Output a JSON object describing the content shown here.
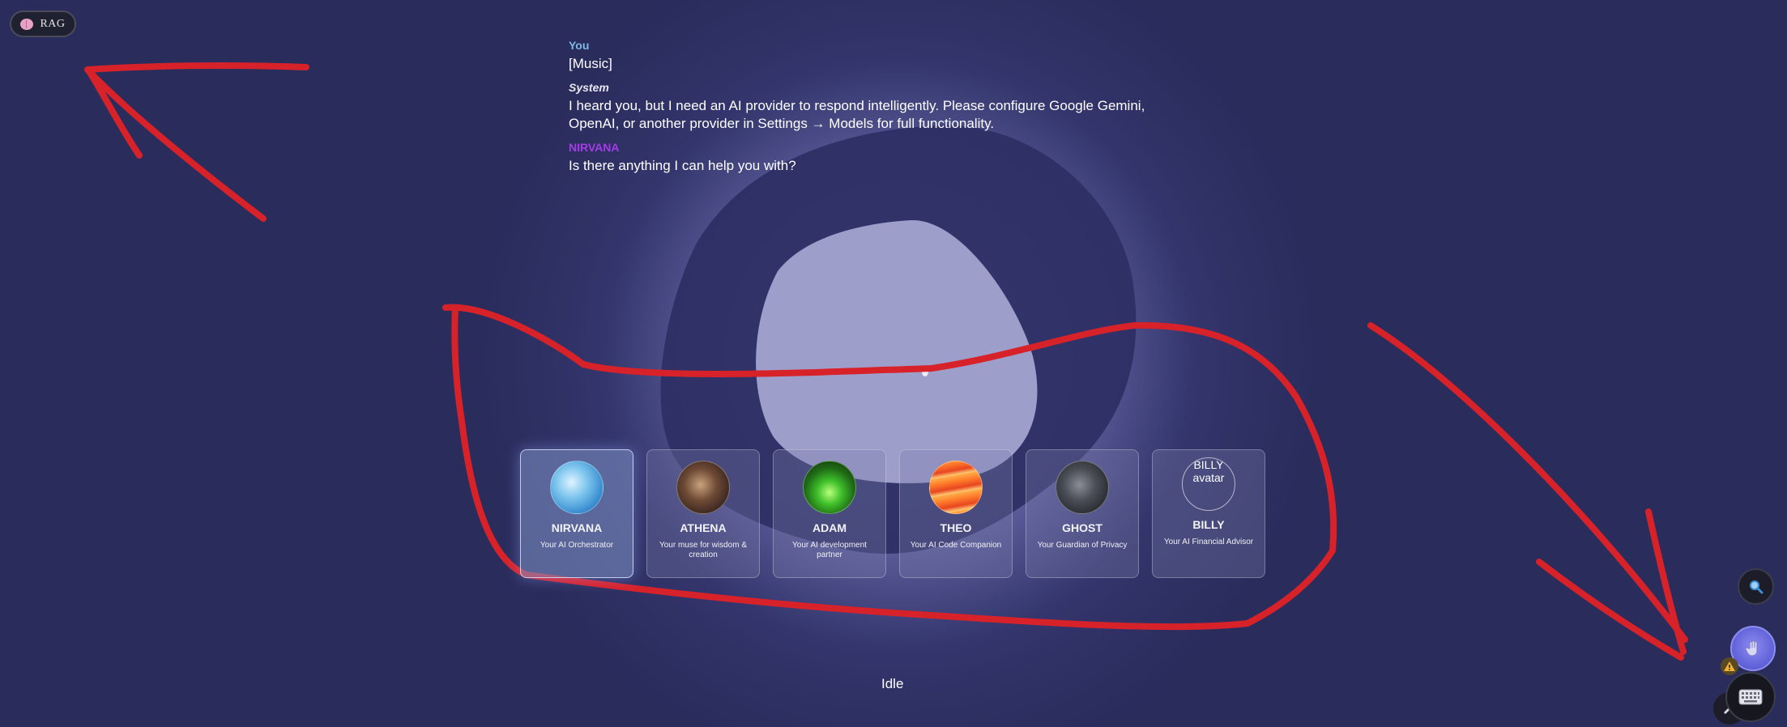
{
  "toolbar": {
    "rag_label": "RAG",
    "rag_icon": "brain-icon"
  },
  "transcript": [
    {
      "speaker": "You",
      "text": "[Music]"
    },
    {
      "speaker": "System",
      "text": "I heard you, but I need an AI provider to respond intelligently. Please configure Google Gemini, OpenAI, or another provider in Settings → Models for full functionality."
    },
    {
      "speaker": "NIRVANA",
      "text": "Is there anything I can help you with?"
    }
  ],
  "agents": [
    {
      "name": "NIRVANA",
      "description": "Your AI Orchestrator",
      "selected": true
    },
    {
      "name": "ATHENA",
      "description": "Your muse for wisdom & creation",
      "selected": false
    },
    {
      "name": "ADAM",
      "description": "Your AI development partner",
      "selected": false
    },
    {
      "name": "THEO",
      "description": "Your AI Code Companion",
      "selected": false
    },
    {
      "name": "GHOST",
      "description": "Your Guardian of Privacy",
      "selected": false
    },
    {
      "name": "BILLY",
      "description": "Your AI Financial Advisor",
      "selected": false,
      "avatar_alt": "BILLY avatar"
    }
  ],
  "status": "Idle",
  "fabs": {
    "search_icon": "magnifier-icon",
    "voice_icon": "hand-icon",
    "warning_icon": "warning-icon",
    "keyboard_icon": "keyboard-icon",
    "wrench_icon": "wrench-icon"
  },
  "colors": {
    "background": "#2a2c5c",
    "orb_glow": "#c9c9e6",
    "annotation_red": "#d8222a",
    "nirvana_purple": "#a43be6",
    "you_blue": "#7fb8e6",
    "voice_button": "#5f5fd8"
  }
}
